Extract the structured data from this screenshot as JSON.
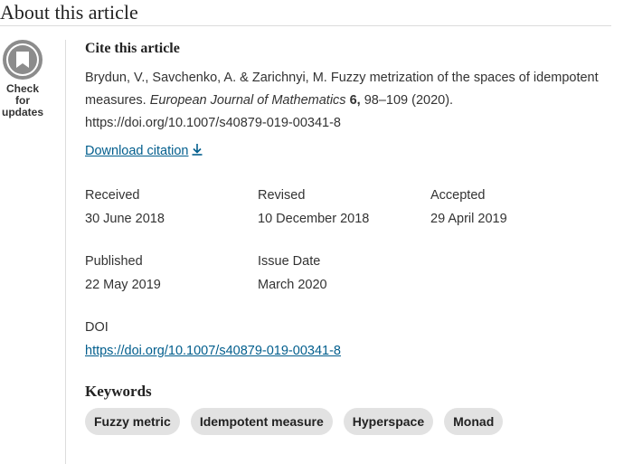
{
  "section": {
    "title": "About this article"
  },
  "badge": {
    "line1": "Check for",
    "line2": "updates"
  },
  "cite": {
    "heading": "Cite this article",
    "authors": "Brydun, V., Savchenko, A. & Zarichnyi, M. Fuzzy metrization of the spaces of idempotent measures.",
    "journal": "European Journal of Mathematics",
    "volume": "6,",
    "pages_year": "98–109 (2020).",
    "doi_text": "https://doi.org/10.1007/s40879-019-00341-8",
    "download_label": "Download citation"
  },
  "history": {
    "received_label": "Received",
    "received_value": "30 June 2018",
    "revised_label": "Revised",
    "revised_value": "10 December 2018",
    "accepted_label": "Accepted",
    "accepted_value": "29 April 2019",
    "published_label": "Published",
    "published_value": "22 May 2019",
    "issue_label": "Issue Date",
    "issue_value": "March 2020"
  },
  "doi": {
    "label": "DOI",
    "link": "https://doi.org/10.1007/s40879-019-00341-8"
  },
  "keywords": {
    "heading": "Keywords",
    "items": [
      "Fuzzy metric",
      "Idempotent measure",
      "Hyperspace",
      "Monad"
    ]
  },
  "colors": {
    "link": "#025e8d",
    "pill": "#e2e2e2",
    "badge": "#8c8c8c"
  },
  "icons": {
    "badge": "check-for-updates-icon",
    "download": "download-icon"
  }
}
